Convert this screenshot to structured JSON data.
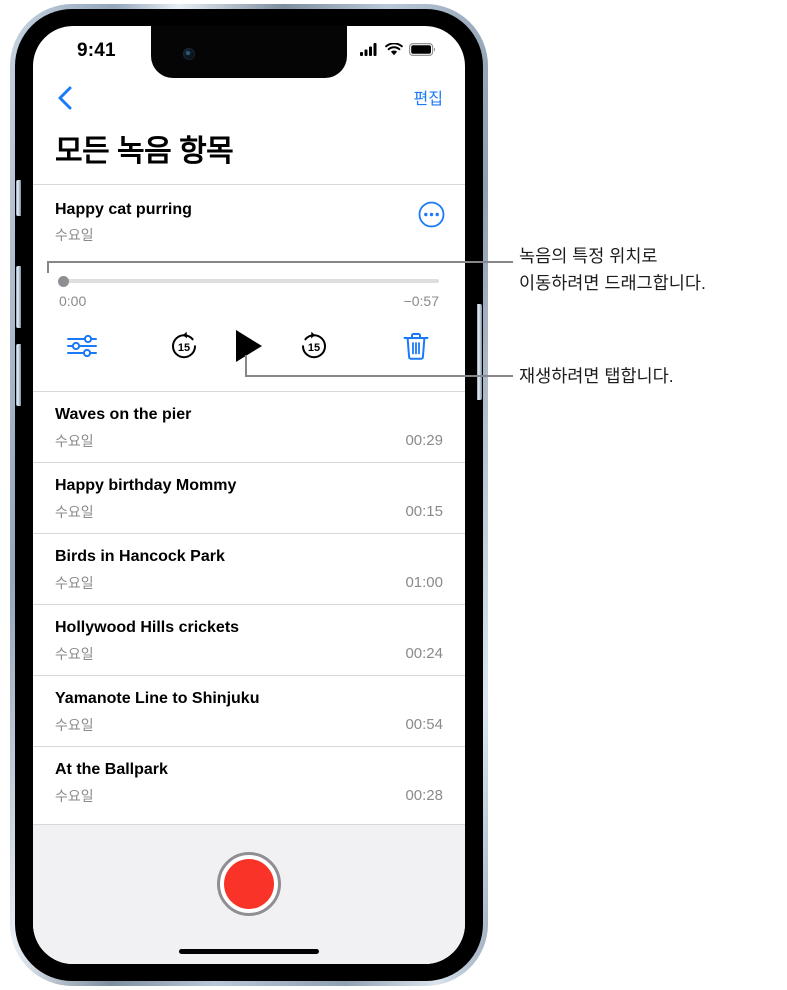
{
  "status_bar": {
    "time": "9:41",
    "cellular_icon": "signal-bars-icon",
    "wifi_icon": "wifi-icon",
    "battery_icon": "battery-icon"
  },
  "nav_bar": {
    "back_icon": "chevron-left-icon",
    "edit_label": "편집"
  },
  "page": {
    "title": "모든 녹음 항목"
  },
  "expanded_recording": {
    "title": "Happy cat purring",
    "date": "수요일",
    "more_options_icon": "ellipsis-circle-icon",
    "elapsed_time": "0:00",
    "remaining_time": "−0:57",
    "scrub_position_percent": 0,
    "controls": {
      "edit_audio_icon": "sliders-icon",
      "skip_back_icon": "skip-back-15-icon",
      "skip_back_label": "15",
      "play_icon": "play-icon",
      "skip_forward_icon": "skip-forward-15-icon",
      "skip_forward_label": "15",
      "delete_icon": "trash-icon"
    }
  },
  "recordings": [
    {
      "title": "Waves on the pier",
      "date": "수요일",
      "duration": "00:29"
    },
    {
      "title": "Happy birthday Mommy",
      "date": "수요일",
      "duration": "00:15"
    },
    {
      "title": "Birds in Hancock Park",
      "date": "수요일",
      "duration": "01:00"
    },
    {
      "title": "Hollywood Hills crickets",
      "date": "수요일",
      "duration": "00:24"
    },
    {
      "title": "Yamanote Line to Shinjuku",
      "date": "수요일",
      "duration": "00:54"
    },
    {
      "title": "At the Ballpark",
      "date": "수요일",
      "duration": "00:28"
    }
  ],
  "record_button": {
    "icon": "record-circle-icon"
  },
  "callouts": [
    {
      "text": "녹음의 특정 위치로\n이동하려면 드래그합니다."
    },
    {
      "text": "재생하려면 탭합니다."
    }
  ],
  "colors": {
    "accent_blue": "#1a7af8",
    "record_red": "#f93327",
    "secondary_text": "#8a8a8e",
    "separator": "#d8d8dc",
    "callout_line": "#86868b",
    "tray_background": "#f1f1f4"
  }
}
